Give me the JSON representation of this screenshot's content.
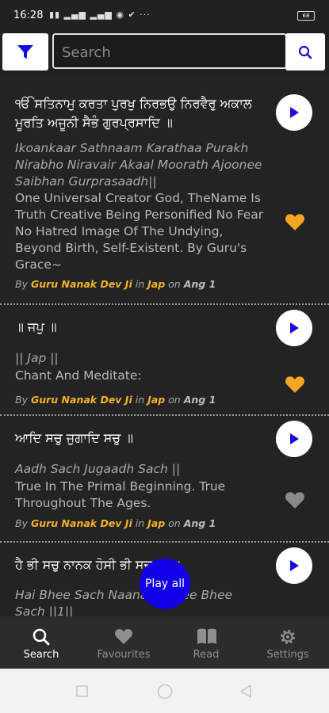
{
  "status": {
    "time": "16:28",
    "battery": "68"
  },
  "search": {
    "placeholder": "Search",
    "value": ""
  },
  "results": [
    {
      "gurmukhi": "ੴ ਸਤਿਨਾਮੁ ਕਰਤਾ ਪੁਰਖੁ ਨਿਰਭਉ ਨਿਰਵੈਰੁ ਅਕਾਲ ਮੂਰਤਿ ਅਜੂਨੀ ਸੈਭੰ ਗੁਰਪ੍ਰਸਾਦਿ ॥",
      "transliteration": "Ikoankaar Sathnaam Karathaa Purakh Nirabho Niravair Akaal Moorath Ajoonee Saibhan Gurprasaadh||",
      "translation": "One Universal Creator God, TheName Is Truth Creative Being Personified No Fear No Hatred Image Of The Undying, Beyond Birth, Self-Existent. By Guru's Grace~",
      "by": "By",
      "author": "Guru Nanak Dev Ji",
      "in": "in",
      "bani": "Jap",
      "on": "on",
      "ang": "Ang 1",
      "favourite": true
    },
    {
      "gurmukhi": "॥ ਜਪੁ ॥",
      "transliteration": "|| Jap ||",
      "translation": "Chant And Meditate:",
      "by": "By",
      "author": "Guru Nanak Dev Ji",
      "in": "in",
      "bani": "Jap",
      "on": "on",
      "ang": "Ang 1",
      "favourite": true
    },
    {
      "gurmukhi": "ਆਦਿ ਸਚੁ ਜੁਗਾਦਿ ਸਚੁ ॥",
      "transliteration": "Aadh Sach Jugaadh Sach ||",
      "translation": "True In The Primal Beginning. True Throughout The Ages.",
      "by": "By",
      "author": "Guru Nanak Dev Ji",
      "in": "in",
      "bani": "Jap",
      "on": "on",
      "ang": "Ang 1",
      "favourite": false
    },
    {
      "gurmukhi": "ਹੈ ਭੀ ਸਚੁ ਨਾਨਕ ਹੋਸੀ ਭੀ ਸਚੁ ॥੧॥",
      "transliteration": "Hai Bhee Sach Naanak Hosee Bhee Sach ||1||",
      "translation": "",
      "by": "",
      "author": "",
      "in": "",
      "bani": "",
      "on": "",
      "ang": "",
      "favourite": false
    }
  ],
  "play_all_label": "Play all",
  "nav": [
    {
      "label": "Search",
      "icon": "search-icon",
      "active": true
    },
    {
      "label": "Favourites",
      "icon": "heart-icon",
      "active": false
    },
    {
      "label": "Read",
      "icon": "book-icon",
      "active": false
    },
    {
      "label": "Settings",
      "icon": "gear-icon",
      "active": false
    }
  ],
  "colors": {
    "accent": "#1200e6",
    "favourite": "#f5a623",
    "unfavourite": "#8a8a8a",
    "highlight": "#f5b128"
  }
}
